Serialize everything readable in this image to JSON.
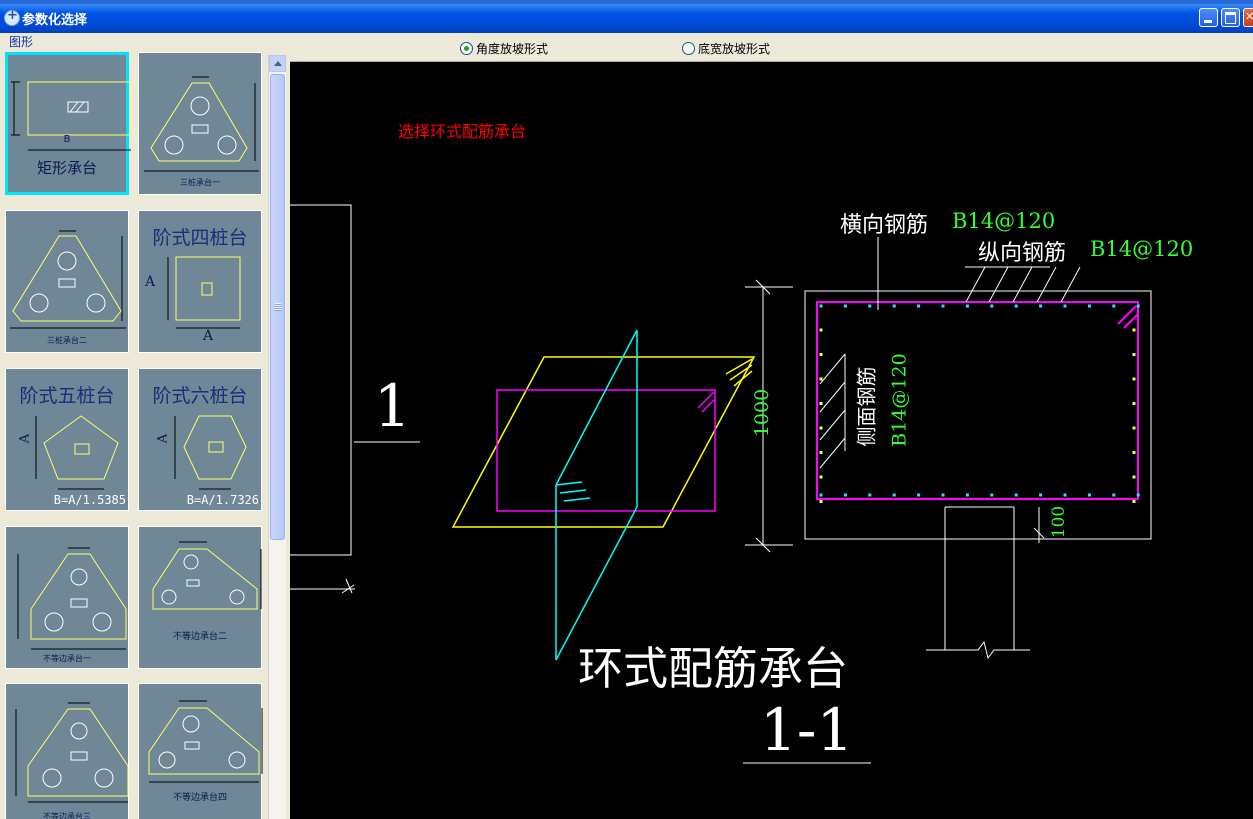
{
  "window": {
    "title": "参数化选择"
  },
  "left_panel": {
    "label": "图形",
    "tiles": [
      {
        "caption": "矩形承台",
        "dim_label": "B"
      },
      {
        "caption": "三桩承台一"
      },
      {
        "caption": "三桩承台二"
      },
      {
        "caption": "阶式四桩台",
        "dim_a": "A",
        "dim_b": "A"
      },
      {
        "caption": "阶式五桩台",
        "dim_a": "A",
        "formula": "B=A/1.5385"
      },
      {
        "caption": "阶式六桩台",
        "dim_a": "A",
        "formula": "B=A/1.7326"
      },
      {
        "caption": "不等边承台一"
      },
      {
        "caption": "不等边承台二"
      },
      {
        "caption": "不等边承台三"
      },
      {
        "caption": "不等边承台四"
      }
    ]
  },
  "options": {
    "angle_slope": "角度放坡形式",
    "width_slope": "底宽放坡形式",
    "selected": "angle_slope"
  },
  "canvas": {
    "prompt": "选择环式配筋承台",
    "section_label": "1",
    "title": "环式配筋承台",
    "section_title": "1-1",
    "transverse_label": "横向钢筋",
    "transverse_value": "B14@120",
    "longitudinal_label": "纵向钢筋",
    "longitudinal_value": "B14@120",
    "side_label": "侧面钢筋",
    "side_value": "B14@120",
    "height_dim": "1000",
    "cover_dim": "100"
  },
  "colors": {
    "title_bar": "#0055e5",
    "tile_bg": "#6f8797",
    "tile_selected": "#00e5ff",
    "cad_bg": "#000000",
    "cad_magenta": "#ff00ff",
    "cad_yellow": "#ffff00",
    "cad_cyan": "#00ffff",
    "cad_green": "#00ff00",
    "cad_red": "#ff0000",
    "cad_white": "#ffffff"
  }
}
